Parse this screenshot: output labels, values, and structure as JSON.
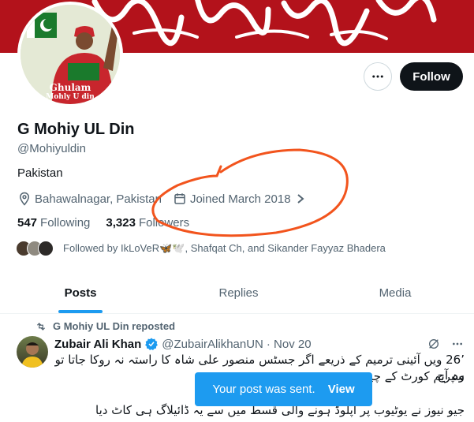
{
  "profile": {
    "avatar_caption_line1": "Ghulam",
    "avatar_caption_line2": "Mohly U din",
    "name": "G Mohiy UL Din",
    "handle": "@Mohiyuldin",
    "bio": "Pakistan",
    "location": "Bahawalnagar, Pakistan",
    "joined": "Joined March 2018",
    "following_count": "547",
    "following_label": "Following",
    "followers_count": "3,323",
    "followers_label": "Followers",
    "followed_by": "Followed by IkLoVeR🦋🕊️, Shafqat Ch, and Sikander Fayyaz Bhadera"
  },
  "actions": {
    "more_icon": "more-horizontal-icon",
    "follow_label": "Follow"
  },
  "tabs": [
    {
      "label": "Posts",
      "active": true
    },
    {
      "label": "Replies",
      "active": false
    },
    {
      "label": "Media",
      "active": false
    }
  ],
  "tweet": {
    "repost_label": "G Mohiy UL Din reposted",
    "author_name": "Zubair Ali Khan",
    "author_handle": "@ZubairAlikhanUN",
    "time": "· Nov 20",
    "text_line1": "’26 ویں آئینی ترمیم کے ذریعے اگر جسٹس منصور علی شاہ کا راستہ نہ روکا جاتا تو وہ آج",
    "text_line2": "سپریم کورٹ کے چیف",
    "text_line3": "جیو نیوز نے یوٹیوب پر اپلوڈ ہونے والی قسط میں سے یہ ڈائیلاگ ہی کاٹ دیا"
  },
  "toast": {
    "message": "Your post was sent.",
    "action": "View"
  },
  "colors": {
    "accent": "#1d9bf0",
    "banner": "#b3121b",
    "annotation": "#f2541d",
    "verified": "#1d9bf0"
  }
}
